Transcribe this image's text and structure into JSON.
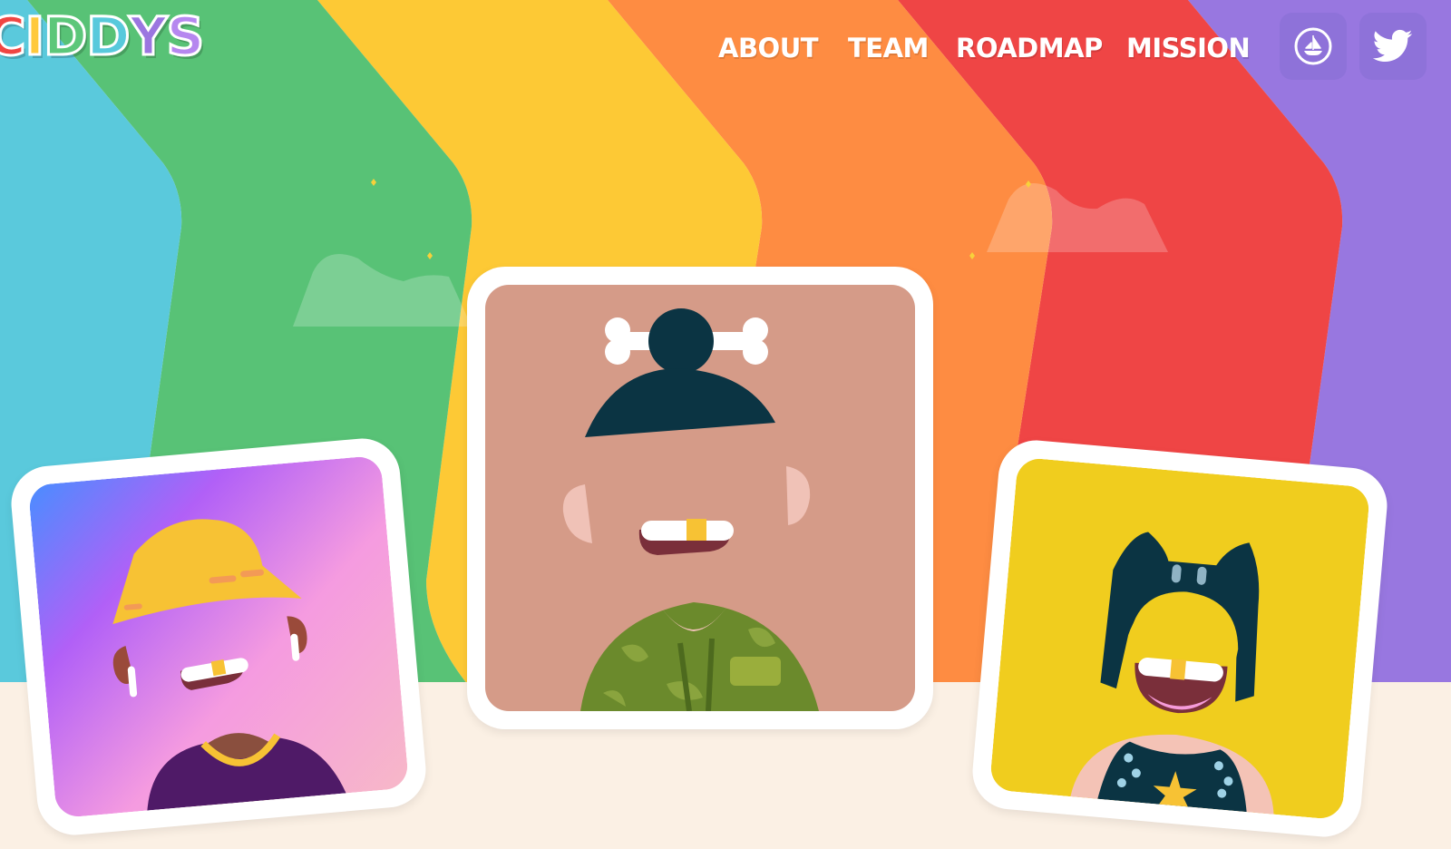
{
  "brand": {
    "logo_letters": [
      "C",
      "I",
      "D",
      "D",
      "Y",
      "S"
    ],
    "logo_colors": [
      "#f04542",
      "#ffc93c",
      "#5cc77a",
      "#58c9dc",
      "#9b76e0",
      "#b687ef"
    ]
  },
  "nav": {
    "links": [
      "ABOUT",
      "TEAM",
      "ROADMAP",
      "MISSION"
    ]
  },
  "social": {
    "opensea_icon": "opensea-icon",
    "twitter_icon": "twitter-icon"
  },
  "theme": {
    "stripe_colors": [
      "#5ac9dc",
      "#58c276",
      "#fdc935",
      "#fe8c42",
      "#ef4545",
      "#9877e0"
    ],
    "ground": "#fbf0e4",
    "social_button": "#8e72d9"
  },
  "avatars": [
    {
      "name": "avatar-bucket-hat",
      "background": "gradient-blue-purple-pink"
    },
    {
      "name": "avatar-bone-bun",
      "background": "#d59b88"
    },
    {
      "name": "avatar-cat-ears",
      "background": "#f0cd1e"
    }
  ]
}
